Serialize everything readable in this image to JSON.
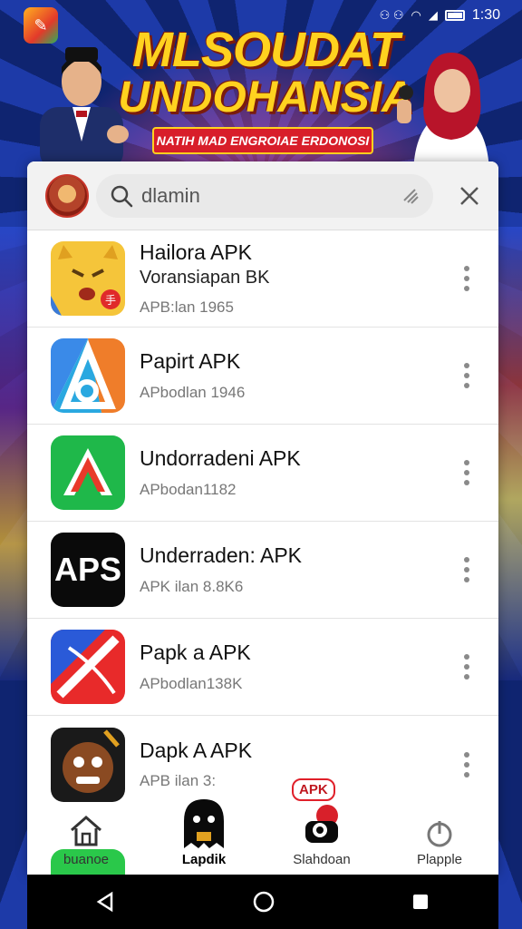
{
  "status_bar": {
    "time": "1:30"
  },
  "banner": {
    "title_line1": "MLSOUDAT",
    "title_line2": "UNDOHANSIA",
    "subtitle": "NATIH MAD ENGROIAE ERDONOSI"
  },
  "search": {
    "query": "dlamin"
  },
  "apps": [
    {
      "name": "Hailora APK",
      "subtitle": "Voransiapan BK",
      "meta": "APB:lan 1965"
    },
    {
      "name": "Papirt APK",
      "subtitle": "",
      "meta": "APbodlan 1946"
    },
    {
      "name": "Undorradeni APK",
      "subtitle": "",
      "meta": "APbodan1182"
    },
    {
      "name": "Underraden: APK",
      "subtitle": "",
      "meta": "APK ilan 8.8K6"
    },
    {
      "name": "Papk a APK",
      "subtitle": "",
      "meta": "APbodlan138K"
    },
    {
      "name": "Dapk A APK",
      "subtitle": "",
      "meta": "APB ilan 3:"
    }
  ],
  "bottom_nav": {
    "badge": "APK",
    "items": [
      {
        "label": "buanoe",
        "icon": "home-icon"
      },
      {
        "label": "Lapdik",
        "icon": "ghost-icon"
      },
      {
        "label": "Slahdoan",
        "icon": "mascot-icon"
      },
      {
        "label": "Plapple",
        "icon": "power-icon"
      }
    ]
  },
  "colors": {
    "accent": "#e0202a",
    "banner_gold": "#ffd21f"
  }
}
